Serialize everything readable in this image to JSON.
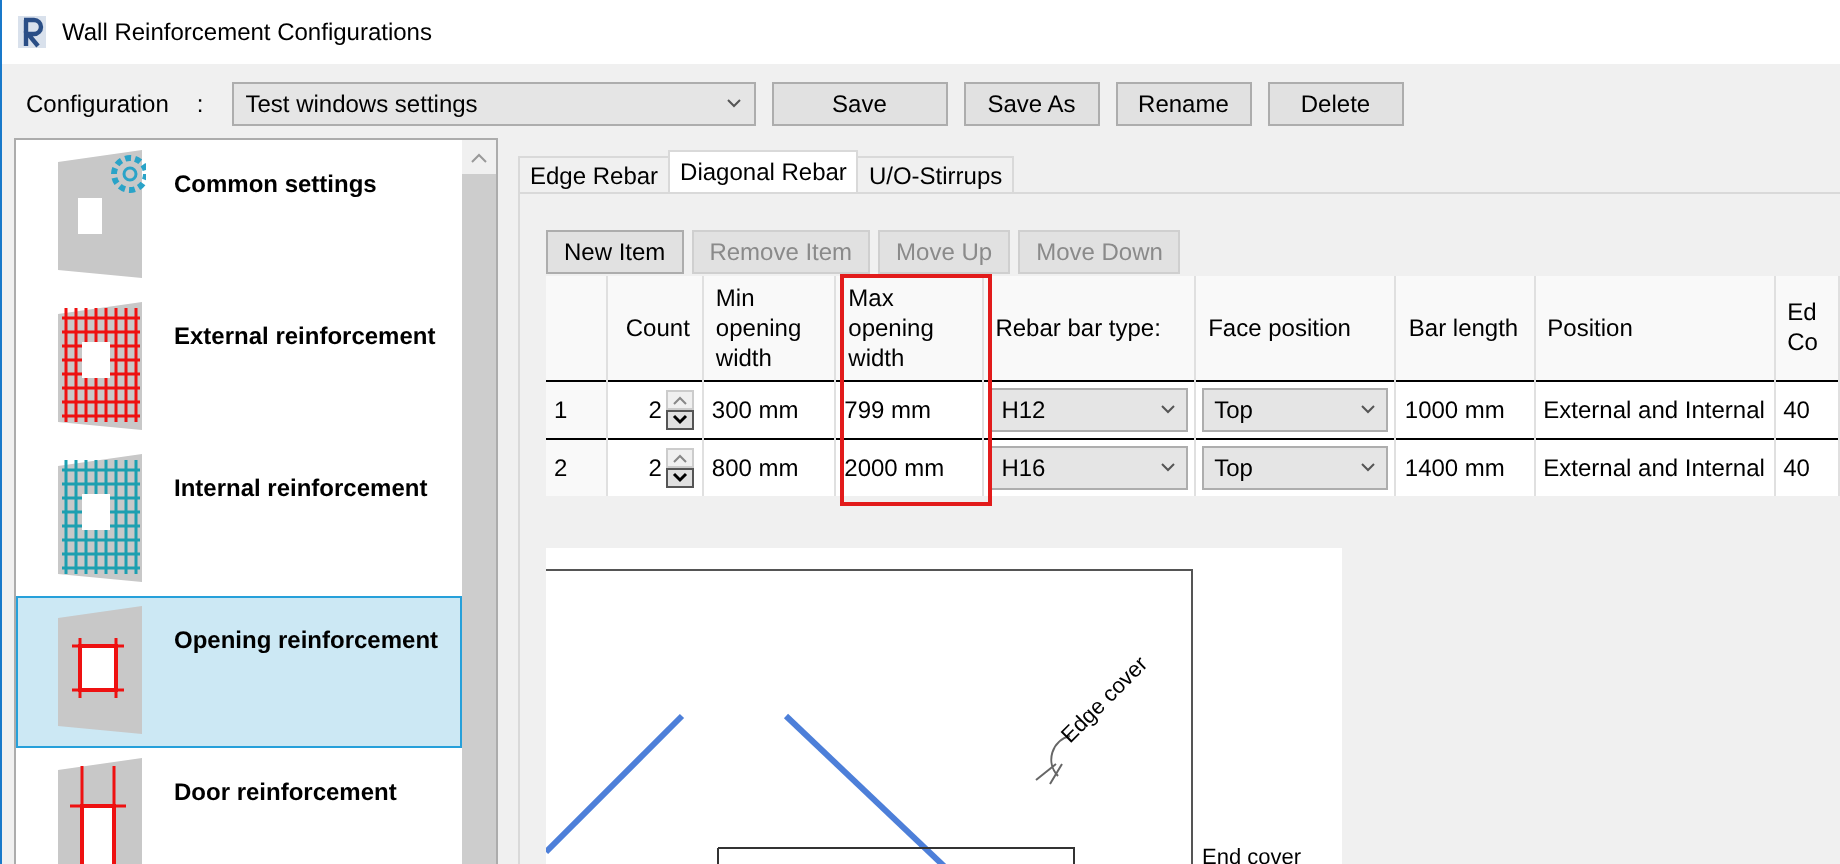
{
  "window": {
    "title": "Wall Reinforcement Configurations"
  },
  "configuration": {
    "label": "Configuration",
    "separator": ":",
    "value": "Test windows settings",
    "buttons": [
      "Save",
      "Save As",
      "Rename",
      "Delete"
    ]
  },
  "sidebar": {
    "items": [
      {
        "label": "Common settings",
        "kind": "common",
        "selected": false
      },
      {
        "label": "External reinforcement",
        "kind": "external",
        "selected": false
      },
      {
        "label": "Internal reinforcement",
        "kind": "internal",
        "selected": false
      },
      {
        "label": "Opening reinforcement",
        "kind": "opening",
        "selected": true
      },
      {
        "label": "Door reinforcement",
        "kind": "door",
        "selected": false
      }
    ]
  },
  "tabs": [
    {
      "label": "Edge Rebar",
      "selected": false
    },
    {
      "label": "Diagonal Rebar",
      "selected": true
    },
    {
      "label": "U/O-Stirrups",
      "selected": false
    }
  ],
  "item_buttons": [
    {
      "label": "New Item",
      "disabled": false
    },
    {
      "label": "Remove Item",
      "disabled": true
    },
    {
      "label": "Move Up",
      "disabled": true
    },
    {
      "label": "Move Down",
      "disabled": true
    }
  ],
  "table": {
    "columns": [
      {
        "label": "Count",
        "highlighted": false
      },
      {
        "label": "Min opening width",
        "highlighted": false
      },
      {
        "label": "Max opening width",
        "highlighted": true
      },
      {
        "label": "Rebar bar type:",
        "highlighted": false
      },
      {
        "label": "Face position",
        "highlighted": false
      },
      {
        "label": "Bar length",
        "highlighted": false
      },
      {
        "label": "Position",
        "highlighted": false
      },
      {
        "label": "Ed Co",
        "highlighted": false
      }
    ],
    "rows": [
      {
        "index": "1",
        "count": "2",
        "min": "300 mm",
        "max": "799 mm",
        "bar_type": "H12",
        "face": "Top",
        "length": "1000 mm",
        "position": "External and Internal",
        "edge": "40"
      },
      {
        "index": "2",
        "count": "2",
        "min": "800 mm",
        "max": "2000 mm",
        "bar_type": "H16",
        "face": "Top",
        "length": "1400 mm",
        "position": "External and Internal",
        "edge": "40"
      }
    ]
  },
  "drawing": {
    "labels": [
      "Edge cover",
      "End cover"
    ]
  }
}
